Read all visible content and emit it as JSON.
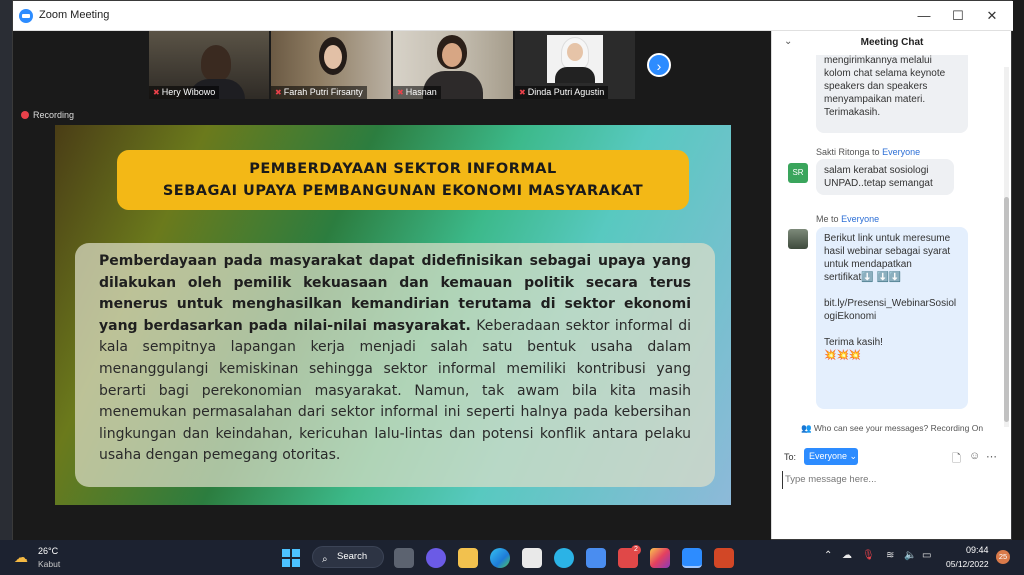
{
  "window": {
    "title": "Zoom Meeting",
    "minimize": "—",
    "maximize": "☐",
    "close": "✕"
  },
  "participants": [
    {
      "name": "Hery Wibowo"
    },
    {
      "name": "Farah Putri Firsanty"
    },
    {
      "name": "Hasnan"
    },
    {
      "name": "Dinda Putri Agustin"
    }
  ],
  "next_arrow": "›",
  "recording": {
    "label": "Recording"
  },
  "slide": {
    "title_line1": "PEMBERDAYAAN SEKTOR INFORMAL",
    "title_line2": "SEBAGAI UPAYA PEMBANGUNAN EKONOMI MASYARAKAT",
    "body_bold": "Pemberdayaan pada masyarakat dapat didefinisikan sebagai upaya yang dilakukan oleh pemilik kekuasaan dan kemauan politik secara terus menerus untuk menghasilkan kemandirian terutama di sektor ekonomi yang berdasarkan pada nilai-nilai masyarakat.",
    "body_regular": " Keberadaan sektor informal di kala sempitnya lapangan kerja menjadi salah satu bentuk usaha dalam menanggulangi kemiskinan sehingga sektor informal memiliki kontribusi yang berarti bagi perekonomian masyarakat. Namun, tak awam bila kita masih menemukan permasalahan dari sektor informal ini seperti halnya pada kebersihan lingkungan dan keindahan, kericuhan lalu-lintas dan potensi konflik antara pelaku usaha dengan pemegang otoritas."
  },
  "chat": {
    "title": "Meeting Chat",
    "messages": [
      {
        "text_partial": "mengirimkannya melalui kolom chat selama keynote speakers dan speakers menyampaikan materi. Terimakasih."
      },
      {
        "sender": "Sakti Ritonga",
        "to_word": "to",
        "to": "Everyone",
        "initials": "SR",
        "avatar_color": "#3aa55c",
        "text": "salam kerabat sosiologi UNPAD..tetap semangat"
      },
      {
        "sender": "Me",
        "to_word": "to",
        "to": "Everyone",
        "text": "Berikut link untuk meresume hasil webinar sebagai syarat untuk mendapatkan sertifikat⬇️ ⬇️⬇️",
        "link": "bit.ly/Presensi_WebinarSosiologiEkonomi",
        "closing": "Terima kasih!",
        "emojis": "💥💥💥"
      }
    ],
    "privacy_note": "Who can see your messages? Recording On",
    "to_label": "To:",
    "to_value": "Everyone",
    "input_placeholder": "Type message here..."
  },
  "taskbar": {
    "weather_temp": "26°C",
    "weather_desc": "Kabut",
    "search_label": "Search",
    "time": "09:44",
    "date": "05/12/2022",
    "notification_count": "25",
    "badge_count": "2"
  },
  "colors": {
    "accent": "#2d8cff",
    "slide_title_bg": "#f3b816",
    "recording": "#e8414a"
  }
}
